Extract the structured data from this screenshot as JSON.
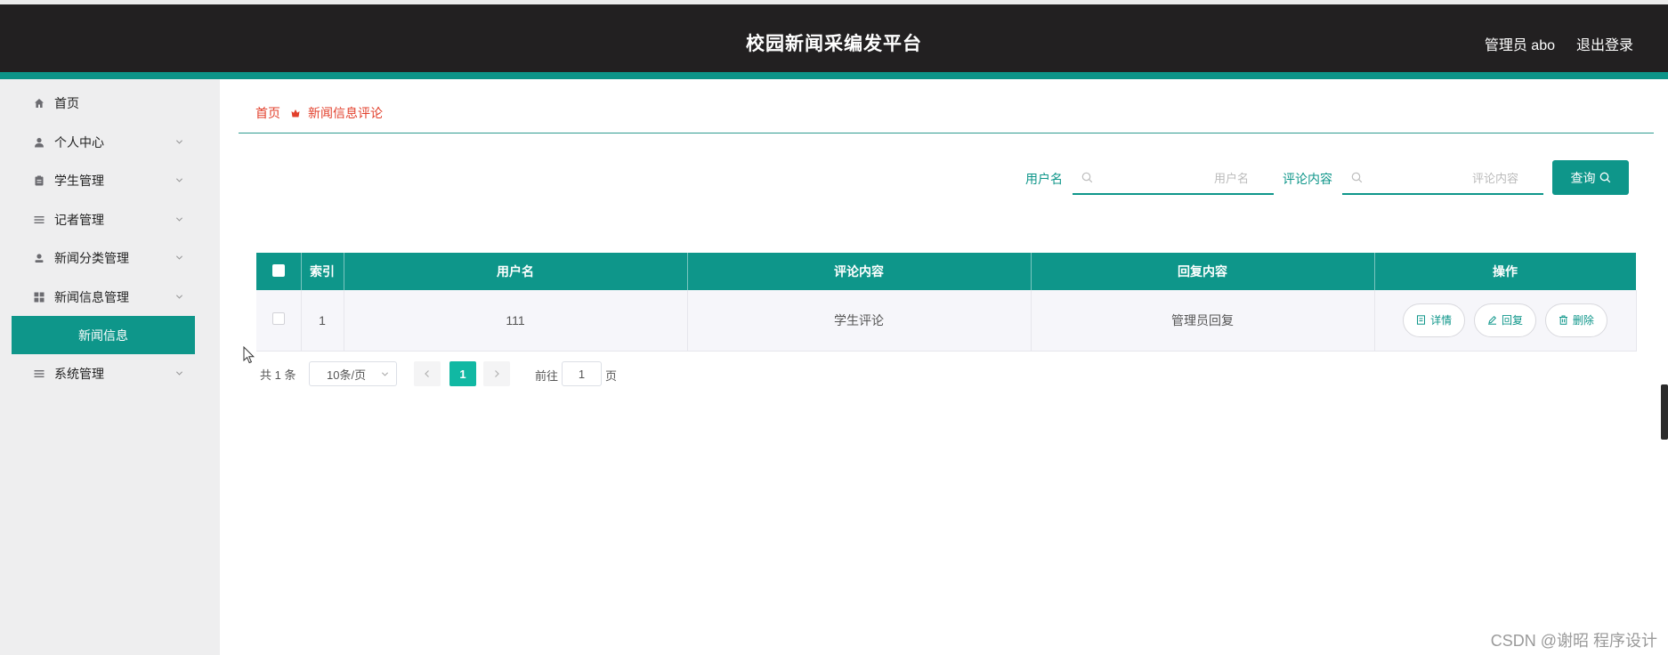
{
  "header": {
    "title": "校园新闻采编发平台",
    "user_label": "管理员 abo",
    "logout_label": "退出登录"
  },
  "sidebar": {
    "items": [
      {
        "label": "首页",
        "icon": "home-icon",
        "has_children": false
      },
      {
        "label": "个人中心",
        "icon": "user-icon",
        "has_children": true
      },
      {
        "label": "学生管理",
        "icon": "clipboard-icon",
        "has_children": true
      },
      {
        "label": "记者管理",
        "icon": "list-icon",
        "has_children": true
      },
      {
        "label": "新闻分类管理",
        "icon": "person-icon",
        "has_children": true
      },
      {
        "label": "新闻信息管理",
        "icon": "grid-icon",
        "has_children": true
      },
      {
        "label": "系统管理",
        "icon": "list-icon",
        "has_children": true
      }
    ],
    "active_sub": "新闻信息"
  },
  "breadcrumb": {
    "home": "首页",
    "current": "新闻信息评论"
  },
  "search": {
    "fields": [
      {
        "label": "用户名",
        "placeholder": "用户名",
        "value": ""
      },
      {
        "label": "评论内容",
        "placeholder": "评论内容",
        "value": ""
      }
    ],
    "button_label": "查询"
  },
  "table": {
    "columns": [
      "索引",
      "用户名",
      "评论内容",
      "回复内容",
      "操作"
    ],
    "rows": [
      {
        "index": "1",
        "username": "111",
        "comment": "学生评论",
        "reply": "管理员回复"
      }
    ],
    "actions": [
      "详情",
      "回复",
      "删除"
    ]
  },
  "pagination": {
    "total_label": "共 1 条",
    "page_size_label": "10条/页",
    "current_page": "1",
    "goto_label": "前往",
    "goto_value": "1",
    "page_unit": "页"
  },
  "watermark": "CSDN @谢昭  程序设计",
  "colors": {
    "accent": "#0e968a",
    "header_bg": "#222021",
    "breadcrumb": "#e23f2b",
    "page_active": "#11b8a3"
  }
}
